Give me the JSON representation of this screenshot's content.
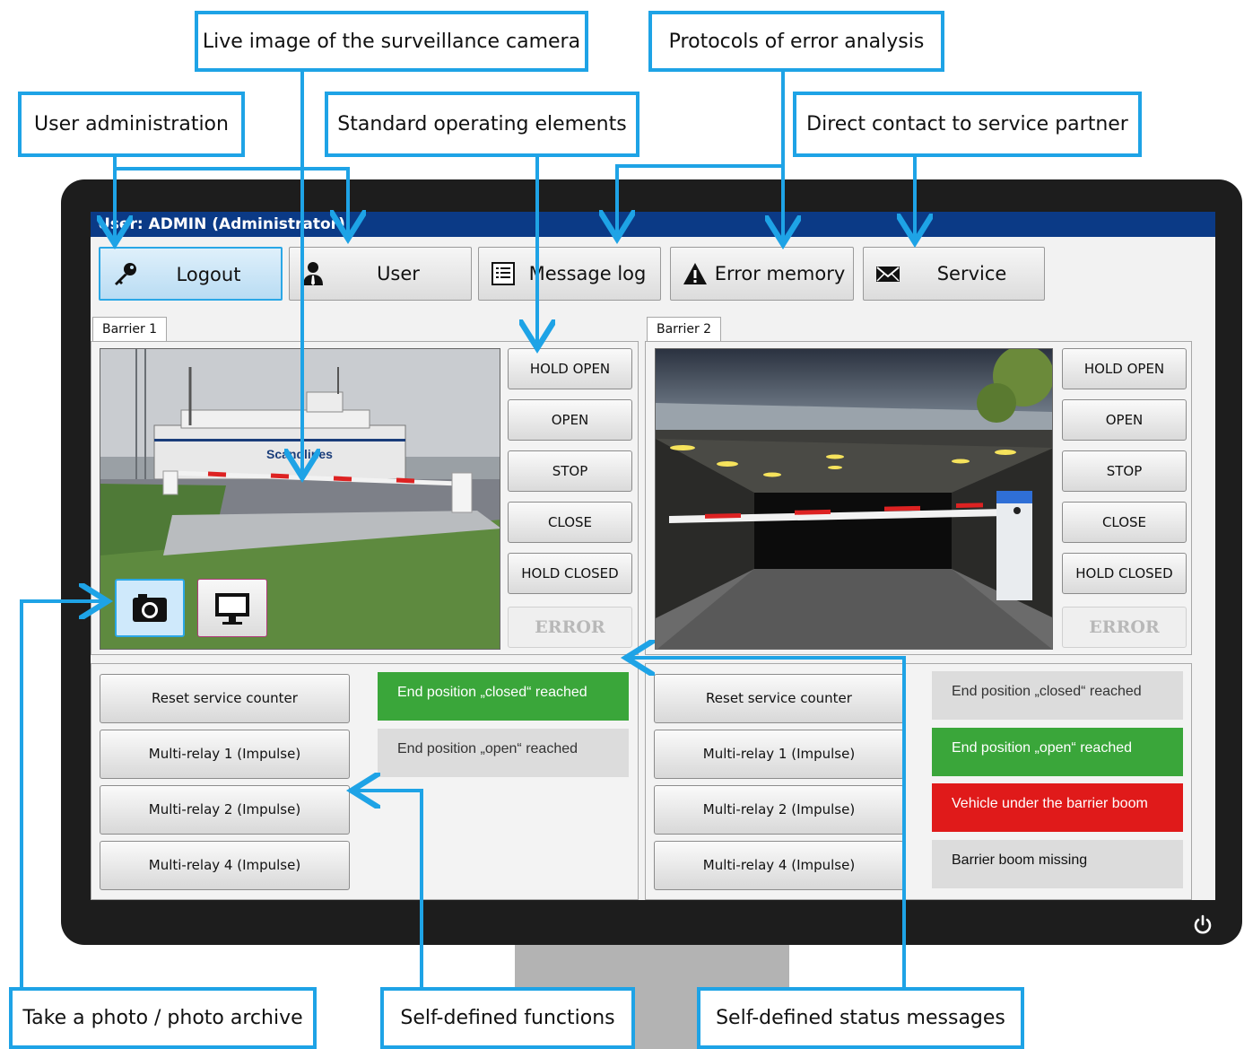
{
  "user_bar": "User: ADMIN (Administrator)",
  "top_buttons": [
    {
      "label": "Logout",
      "icon": "key-icon"
    },
    {
      "label": "User",
      "icon": "person-icon"
    },
    {
      "label": "Message log",
      "icon": "list-icon"
    },
    {
      "label": "Error memory",
      "icon": "warning-icon"
    },
    {
      "label": "Service",
      "icon": "envelope-icon"
    }
  ],
  "barriers": [
    {
      "tab": "Barrier 1",
      "controls": [
        "HOLD OPEN",
        "OPEN",
        "STOP",
        "CLOSE",
        "HOLD CLOSED"
      ],
      "error": "ERROR",
      "camera_text": "Scandlines",
      "functions": [
        "Reset service counter",
        "Multi-relay 1 (Impulse)",
        "Multi-relay 2 (Impulse)",
        "Multi-relay 4 (Impulse)"
      ],
      "statuses": [
        {
          "label": "End position „closed“ reached",
          "color": "#3aa63a"
        },
        {
          "label": "End position „open“ reached",
          "color": "#dcdcdc"
        }
      ]
    },
    {
      "tab": "Barrier 2",
      "controls": [
        "HOLD OPEN",
        "OPEN",
        "STOP",
        "CLOSE",
        "HOLD CLOSED"
      ],
      "error": "ERROR",
      "functions": [
        "Reset service counter",
        "Multi-relay 1 (Impulse)",
        "Multi-relay 2 (Impulse)",
        "Multi-relay 4 (Impulse)"
      ],
      "statuses": [
        {
          "label": "End position „closed“ reached",
          "color": "#dcdcdc"
        },
        {
          "label": "End position „open“ reached",
          "color": "#3aa63a"
        },
        {
          "label": "Vehicle under the barrier boom",
          "color": "#e01a1a"
        },
        {
          "label": "Barrier boom missing",
          "color": "#dcdcdc"
        }
      ]
    }
  ],
  "camera_buttons": [
    {
      "icon": "camera-icon"
    },
    {
      "icon": "monitor-icon"
    }
  ],
  "callouts": {
    "live_image": "Live image of the surveillance camera",
    "protocols": "Protocols of error analysis",
    "user_admin": "User administration",
    "standard_ops": "Standard operating elements",
    "direct_contact": "Direct contact to service partner",
    "take_photo": "Take a photo / photo archive",
    "self_functions": "Self-defined functions",
    "self_status": "Self-defined status messages"
  },
  "colors": {
    "accent": "#1ea3e6",
    "userbar": "#0b3a86",
    "green": "#3aa63a",
    "red": "#e01a1a",
    "grey": "#dcdcdc"
  }
}
